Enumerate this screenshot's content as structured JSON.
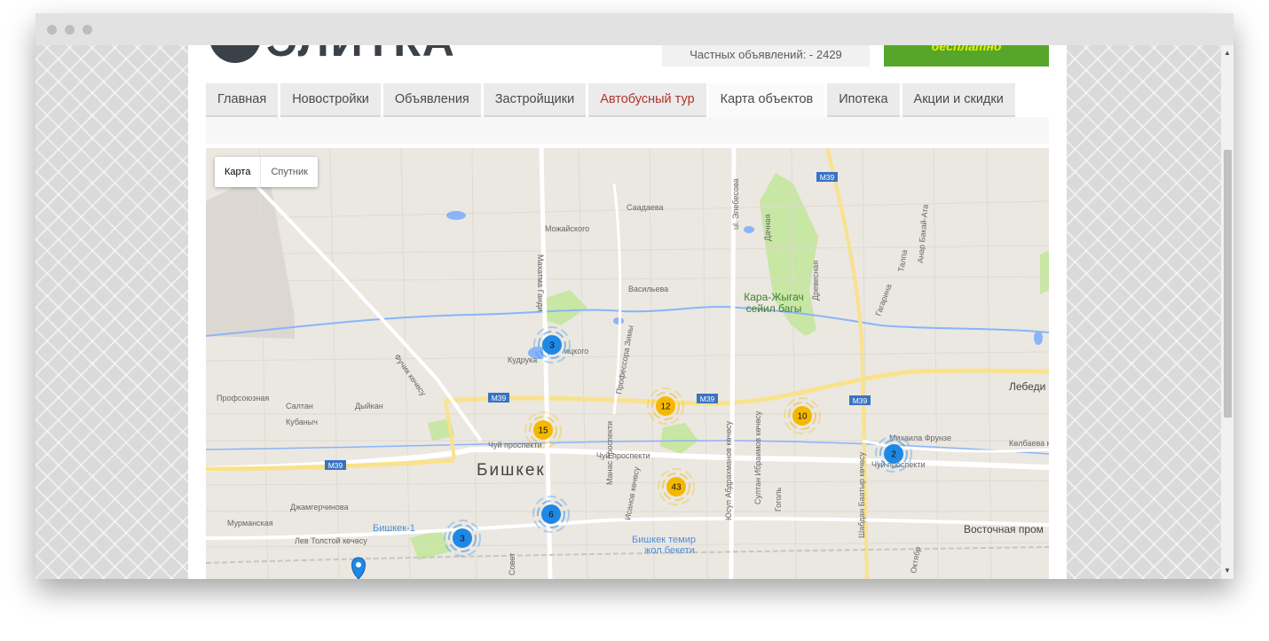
{
  "site": {
    "logo_text": "ЭЛИТКА",
    "private_ads": "Частных объявлений: - 2429",
    "cta_label": "бесплатно"
  },
  "nav": {
    "tabs": [
      {
        "label": "Главная"
      },
      {
        "label": "Новостройки"
      },
      {
        "label": "Объявления"
      },
      {
        "label": "Застройщики"
      },
      {
        "label": "Автобусный тур"
      },
      {
        "label": "Карта объектов"
      },
      {
        "label": "Ипотека"
      },
      {
        "label": "Акции и скидки"
      }
    ]
  },
  "map": {
    "type_buttons": {
      "map": "Карта",
      "satellite": "Спутник"
    },
    "city_label": "Бишкек",
    "place_labels": {
      "kara_zhygach": "Кара-Жыгач",
      "park": "сейил багы",
      "station1": "Бишкек-1",
      "station2a": "Бишкек темир",
      "station2b": "жол бекети",
      "east": "Восточная пром",
      "lebedi": "Лебеди"
    },
    "road_badges": {
      "m39": "M39"
    },
    "street_labels": {
      "chuy1": "Чуй проспекти",
      "chuy2": "Чуй проспекти",
      "chuy3": "Чуй проспекти",
      "frunze": "Михаила Фрунзе",
      "kelbaeva": "Кѳлбаева кѳчѳсу",
      "kudryka": "Кудрука",
      "profsoyuznaya": "Профсоюзная",
      "saltan": "Салтан",
      "kubanych": "Кубаныч",
      "dyykan": "Дыйкан",
      "dzhamgerchinova": "Джамгерчинова",
      "murmanskaya": "Мурманская",
      "lev_tolstoy": "Лев Толстой кѳчѳсу",
      "vasileva": "Васильева",
      "mozhayskogo": "Можайского",
      "saadaeva": "Саадаева",
      "elebesova": "ul. Элебесова",
      "manas": "Манас проспекти",
      "abdrakhmanov": "Юсуп Абдрахманов кѳчѳсу",
      "sultan": "Султан Ибраимов кѳчѳсу",
      "shabdan": "Шабдан Баатыр кѳчѳсу",
      "fuchik": "Фучик кѳчѳсу",
      "makhatma": "Махатма Ганди",
      "profsora": "Профессора Зимы",
      "ivanova": "Исанов кѳчѳсу",
      "drevesnaya": "Древесная",
      "dachnaya": "Дачная",
      "gagarina": "Гагарина",
      "talpa": "Талпа",
      "anar": "Анар Бакай-Ата",
      "oktyabr": "Октябр",
      "sovetskaya": "Совѳт",
      "gogol": "Гоголь",
      "ickogo": "ицкого"
    },
    "clusters": [
      {
        "count": "3",
        "color": "#1e88e5"
      },
      {
        "count": "12",
        "color": "#f5b800"
      },
      {
        "count": "10",
        "color": "#f5b800"
      },
      {
        "count": "15",
        "color": "#f5b800"
      },
      {
        "count": "2",
        "color": "#1e88e5"
      },
      {
        "count": "43",
        "color": "#f5b800"
      },
      {
        "count": "6",
        "color": "#1e88e5"
      },
      {
        "count": "3",
        "color": "#1e88e5"
      }
    ]
  },
  "colors": {
    "brand_green": "#55a62a",
    "cta_text": "#e6f000",
    "highlight_tab": "#b2342a",
    "map_bg": "#ebe7e1",
    "road_yellow": "#f9e28c",
    "water": "#8ab4f8",
    "park": "#c8e6a4"
  }
}
